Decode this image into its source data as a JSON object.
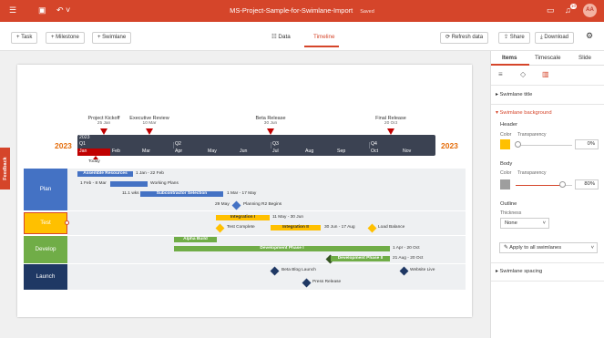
{
  "topbar": {
    "title": "MS-Project-Sample-for-Swimlane-Import",
    "saved": "Saved",
    "avatar": "AA",
    "notif_count": "10"
  },
  "toolbar": {
    "task": "+ Task",
    "milestone": "+ Milestone",
    "swimlane": "+ Swimlane",
    "data": "Data",
    "timeline": "Timeline",
    "refresh": "Refresh data",
    "share": "Share",
    "download": "Download"
  },
  "feedback": "Feedback",
  "milestones": [
    {
      "label": "Project Kickoff",
      "date": "25 Jan"
    },
    {
      "label": "Executive Review",
      "date": "10 Mar"
    },
    {
      "label": "Beta Release",
      "date": "30 Jun"
    },
    {
      "label": "Final Release",
      "date": "20 Oct"
    }
  ],
  "years": {
    "left": "2023",
    "right": "2023",
    "scale": "2023"
  },
  "quarters": [
    "Q1",
    "Q2",
    "Q3",
    "Q4"
  ],
  "months": [
    "Jan",
    "Feb",
    "Mar",
    "Apr",
    "May",
    "Jun",
    "Jul",
    "Aug",
    "Sep",
    "Oct",
    "Nov"
  ],
  "today": "Today",
  "lanes": [
    {
      "label": "Plan"
    },
    {
      "label": "Test"
    },
    {
      "label": "Develop"
    },
    {
      "label": "Launch"
    }
  ],
  "tasks": {
    "assemble": "Assemble Resources",
    "assemble_dates": "1 Jan - 22 Feb",
    "working_dates": "1 Feb - 8 Mar",
    "working": "Working Plans",
    "subcontractor_pre": "11.1 wks",
    "subcontractor": "Subcontractor Selection",
    "subcontractor_dates": "1 Mar - 17 May",
    "planning_date": "29 May",
    "planning": "Planning R2 Begins",
    "integration1": "Integration I",
    "integration1_dates": "11 May - 30 Jun",
    "testcomplete": "Test Complete",
    "integration2": "Integration II",
    "integration2_dates": "30 Jun - 17 Aug",
    "loadbalance": "Load Balance",
    "alpha": "Alpha Build",
    "devphase1": "Development Phase I",
    "devphase1_dates": "1 Apr - 20 Oct",
    "devphase2": "Development Phase II",
    "devphase2_dates": "21 Aug - 20 Oct",
    "beta": "Beta Blog Launch",
    "website": "Website Live",
    "press": "Press Release"
  },
  "panel": {
    "tabs": [
      "Items",
      "Timescale",
      "Slide"
    ],
    "swimlane_title": "Swimlane title",
    "swimlane_background": "Swimlane background",
    "header": "Header",
    "color": "Color",
    "transparency": "Transparency",
    "header_transparency": "0%",
    "body": "Body",
    "body_transparency": "80%",
    "outline": "Outline",
    "thickness": "Thickness",
    "thickness_value": "None",
    "apply_all": "Apply to all swimlanes",
    "swimlane_spacing": "Swimlane spacing"
  },
  "colors": {
    "accent": "#d5452a",
    "plan": "#4472c4",
    "test": "#ffc000",
    "develop": "#70ad47",
    "launch": "#1f3864"
  }
}
